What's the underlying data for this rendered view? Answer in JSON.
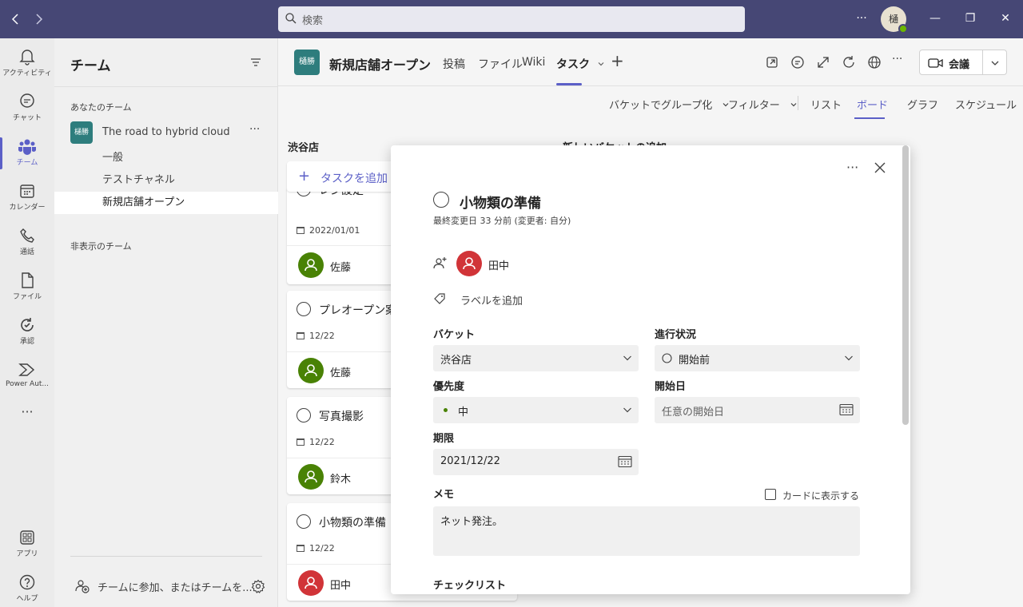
{
  "titlebar": {
    "back_icon": "chevron-left-icon",
    "forward_icon": "chevron-right-icon",
    "search_placeholder": "検索",
    "more": "···",
    "avatar_initial": "樋",
    "minimize": "—",
    "maximize": "❐",
    "close": "✕"
  },
  "rail": {
    "items": [
      {
        "label": "アクティビティ",
        "icon": "bell-icon"
      },
      {
        "label": "チャット",
        "icon": "chat-icon"
      },
      {
        "label": "チーム",
        "icon": "teams-icon"
      },
      {
        "label": "カレンダー",
        "icon": "calendar-icon"
      },
      {
        "label": "通話",
        "icon": "phone-icon"
      },
      {
        "label": "ファイル",
        "icon": "file-icon"
      },
      {
        "label": "承認",
        "icon": "approval-icon"
      },
      {
        "label": "Power Aut...",
        "icon": "power-automate-icon"
      },
      {
        "label": "···",
        "icon": "more-apps-icon"
      },
      {
        "label": "アプリ",
        "icon": "apps-icon"
      },
      {
        "label": "ヘルプ",
        "icon": "help-icon"
      }
    ]
  },
  "team_panel": {
    "title": "チーム",
    "your_teams": "あなたのチーム",
    "team": {
      "icon_text": "樋勝",
      "name": "The road to hybrid cloud",
      "more": "···"
    },
    "channels": [
      "一般",
      "テストチャネル",
      "新規店舗オープン"
    ],
    "hidden_teams": "非表示のチーム",
    "join_text": "チームに参加、またはチームを..."
  },
  "header": {
    "channel_icon_text": "樋勝",
    "channel_title": "新規店舗オープン",
    "tabs": [
      "投稿",
      "ファイル",
      "Wiki",
      "タスク"
    ],
    "add_tab": "+",
    "meet_label": "会議",
    "more": "···"
  },
  "toolbar": {
    "group_by": "バケットでグループ化",
    "filter": "フィルター",
    "list": "リスト",
    "board": "ボード",
    "chart": "グラフ",
    "schedule": "スケジュール"
  },
  "board": {
    "bucket_name": "渋谷店",
    "new_bucket": "新しいバケットの追加",
    "add_task": "タスクを追加",
    "cards": [
      {
        "title": "レジ設定",
        "date": "2022/01/01",
        "assignee": "佐藤"
      },
      {
        "title": "プレオープン案内",
        "date": "12/22",
        "assignee": "佐藤"
      },
      {
        "title": "写真撮影",
        "date": "12/22",
        "assignee": "鈴木"
      },
      {
        "title": "小物類の準備",
        "date": "12/22",
        "assignee": "田中"
      }
    ]
  },
  "dialog": {
    "more": "···",
    "task_title": "小物類の準備",
    "modified": "最終変更日 33 分前 (変更者: 自分)",
    "assignee": "田中",
    "add_label": "ラベルを追加",
    "bucket_label": "バケット",
    "bucket_value": "渋谷店",
    "progress_label": "進行状況",
    "progress_value": "開始前",
    "priority_label": "優先度",
    "priority_value": "中",
    "start_label": "開始日",
    "start_placeholder": "任意の開始日",
    "due_label": "期限",
    "due_value": "2021/12/22",
    "memo_label": "メモ",
    "show_on_card": "カードに表示する",
    "memo_value": "ネット発注。",
    "checklist_label": "チェックリスト"
  },
  "colors": {
    "titlebar": "#464775",
    "accent": "#5b5fc7",
    "team_icon": "#2e7d7d",
    "avatar_green": "#498205",
    "avatar_red": "#d13438"
  }
}
